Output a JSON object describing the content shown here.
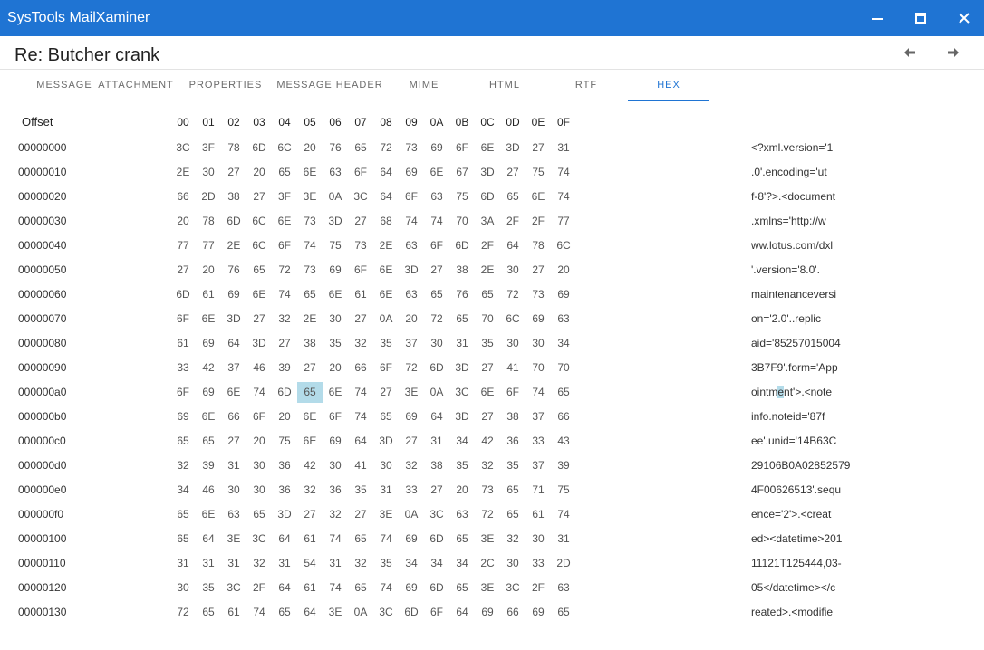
{
  "window": {
    "title": "SysTools MailXaminer",
    "minimize_icon": "minimize-icon",
    "maximize_icon": "maximize-icon",
    "close_icon": "close-icon"
  },
  "message": {
    "subject": "Re: Butcher crank",
    "prev_icon": "arrow-left-icon",
    "next_icon": "arrow-right-icon"
  },
  "tabs": [
    {
      "label": "MESSAGE",
      "active": false
    },
    {
      "label": "ATTACHMENT",
      "active": false
    },
    {
      "label": "PROPERTIES",
      "active": false
    },
    {
      "label": "MESSAGE HEADER",
      "active": false
    },
    {
      "label": "MIME",
      "active": false
    },
    {
      "label": "HTML",
      "active": false
    },
    {
      "label": "RTF",
      "active": false
    },
    {
      "label": "HEX",
      "active": true
    }
  ],
  "hex": {
    "offset_header": "Offset",
    "columns": [
      "00",
      "01",
      "02",
      "03",
      "04",
      "05",
      "06",
      "07",
      "08",
      "09",
      "0A",
      "0B",
      "0C",
      "0D",
      "0E",
      "0F"
    ],
    "selected": {
      "row": 10,
      "col": 5
    },
    "rows": [
      {
        "offset": "00000000",
        "bytes": [
          "3C",
          "3F",
          "78",
          "6D",
          "6C",
          "20",
          "76",
          "65",
          "72",
          "73",
          "69",
          "6F",
          "6E",
          "3D",
          "27",
          "31"
        ],
        "ascii": "<?xml.version='1"
      },
      {
        "offset": "00000010",
        "bytes": [
          "2E",
          "30",
          "27",
          "20",
          "65",
          "6E",
          "63",
          "6F",
          "64",
          "69",
          "6E",
          "67",
          "3D",
          "27",
          "75",
          "74"
        ],
        "ascii": ".0'.encoding='ut"
      },
      {
        "offset": "00000020",
        "bytes": [
          "66",
          "2D",
          "38",
          "27",
          "3F",
          "3E",
          "0A",
          "3C",
          "64",
          "6F",
          "63",
          "75",
          "6D",
          "65",
          "6E",
          "74"
        ],
        "ascii": "f-8'?>.<document"
      },
      {
        "offset": "00000030",
        "bytes": [
          "20",
          "78",
          "6D",
          "6C",
          "6E",
          "73",
          "3D",
          "27",
          "68",
          "74",
          "74",
          "70",
          "3A",
          "2F",
          "2F",
          "77"
        ],
        "ascii": ".xmlns='http://w"
      },
      {
        "offset": "00000040",
        "bytes": [
          "77",
          "77",
          "2E",
          "6C",
          "6F",
          "74",
          "75",
          "73",
          "2E",
          "63",
          "6F",
          "6D",
          "2F",
          "64",
          "78",
          "6C"
        ],
        "ascii": "ww.lotus.com/dxl"
      },
      {
        "offset": "00000050",
        "bytes": [
          "27",
          "20",
          "76",
          "65",
          "72",
          "73",
          "69",
          "6F",
          "6E",
          "3D",
          "27",
          "38",
          "2E",
          "30",
          "27",
          "20"
        ],
        "ascii": "'.version='8.0'."
      },
      {
        "offset": "00000060",
        "bytes": [
          "6D",
          "61",
          "69",
          "6E",
          "74",
          "65",
          "6E",
          "61",
          "6E",
          "63",
          "65",
          "76",
          "65",
          "72",
          "73",
          "69"
        ],
        "ascii": "maintenanceversi"
      },
      {
        "offset": "00000070",
        "bytes": [
          "6F",
          "6E",
          "3D",
          "27",
          "32",
          "2E",
          "30",
          "27",
          "0A",
          "20",
          "72",
          "65",
          "70",
          "6C",
          "69",
          "63"
        ],
        "ascii": "on='2.0'..replic"
      },
      {
        "offset": "00000080",
        "bytes": [
          "61",
          "69",
          "64",
          "3D",
          "27",
          "38",
          "35",
          "32",
          "35",
          "37",
          "30",
          "31",
          "35",
          "30",
          "30",
          "34"
        ],
        "ascii": "aid='85257015004"
      },
      {
        "offset": "00000090",
        "bytes": [
          "33",
          "42",
          "37",
          "46",
          "39",
          "27",
          "20",
          "66",
          "6F",
          "72",
          "6D",
          "3D",
          "27",
          "41",
          "70",
          "70"
        ],
        "ascii": "3B7F9'.form='App"
      },
      {
        "offset": "000000a0",
        "bytes": [
          "6F",
          "69",
          "6E",
          "74",
          "6D",
          "65",
          "6E",
          "74",
          "27",
          "3E",
          "0A",
          "3C",
          "6E",
          "6F",
          "74",
          "65"
        ],
        "ascii": "ointment'>.<note"
      },
      {
        "offset": "000000b0",
        "bytes": [
          "69",
          "6E",
          "66",
          "6F",
          "20",
          "6E",
          "6F",
          "74",
          "65",
          "69",
          "64",
          "3D",
          "27",
          "38",
          "37",
          "66"
        ],
        "ascii": "info.noteid='87f"
      },
      {
        "offset": "000000c0",
        "bytes": [
          "65",
          "65",
          "27",
          "20",
          "75",
          "6E",
          "69",
          "64",
          "3D",
          "27",
          "31",
          "34",
          "42",
          "36",
          "33",
          "43"
        ],
        "ascii": "ee'.unid='14B63C"
      },
      {
        "offset": "000000d0",
        "bytes": [
          "32",
          "39",
          "31",
          "30",
          "36",
          "42",
          "30",
          "41",
          "30",
          "32",
          "38",
          "35",
          "32",
          "35",
          "37",
          "39"
        ],
        "ascii": "29106B0A02852579"
      },
      {
        "offset": "000000e0",
        "bytes": [
          "34",
          "46",
          "30",
          "30",
          "36",
          "32",
          "36",
          "35",
          "31",
          "33",
          "27",
          "20",
          "73",
          "65",
          "71",
          "75"
        ],
        "ascii": "4F00626513'.sequ"
      },
      {
        "offset": "000000f0",
        "bytes": [
          "65",
          "6E",
          "63",
          "65",
          "3D",
          "27",
          "32",
          "27",
          "3E",
          "0A",
          "3C",
          "63",
          "72",
          "65",
          "61",
          "74"
        ],
        "ascii": "ence='2'>.<creat"
      },
      {
        "offset": "00000100",
        "bytes": [
          "65",
          "64",
          "3E",
          "3C",
          "64",
          "61",
          "74",
          "65",
          "74",
          "69",
          "6D",
          "65",
          "3E",
          "32",
          "30",
          "31"
        ],
        "ascii": "ed><datetime>201"
      },
      {
        "offset": "00000110",
        "bytes": [
          "31",
          "31",
          "31",
          "32",
          "31",
          "54",
          "31",
          "32",
          "35",
          "34",
          "34",
          "34",
          "2C",
          "30",
          "33",
          "2D"
        ],
        "ascii": "11121T125444,03-"
      },
      {
        "offset": "00000120",
        "bytes": [
          "30",
          "35",
          "3C",
          "2F",
          "64",
          "61",
          "74",
          "65",
          "74",
          "69",
          "6D",
          "65",
          "3E",
          "3C",
          "2F",
          "63"
        ],
        "ascii": "05</datetime></c"
      },
      {
        "offset": "00000130",
        "bytes": [
          "72",
          "65",
          "61",
          "74",
          "65",
          "64",
          "3E",
          "0A",
          "3C",
          "6D",
          "6F",
          "64",
          "69",
          "66",
          "69",
          "65"
        ],
        "ascii": "reated>.<modifie"
      }
    ]
  }
}
